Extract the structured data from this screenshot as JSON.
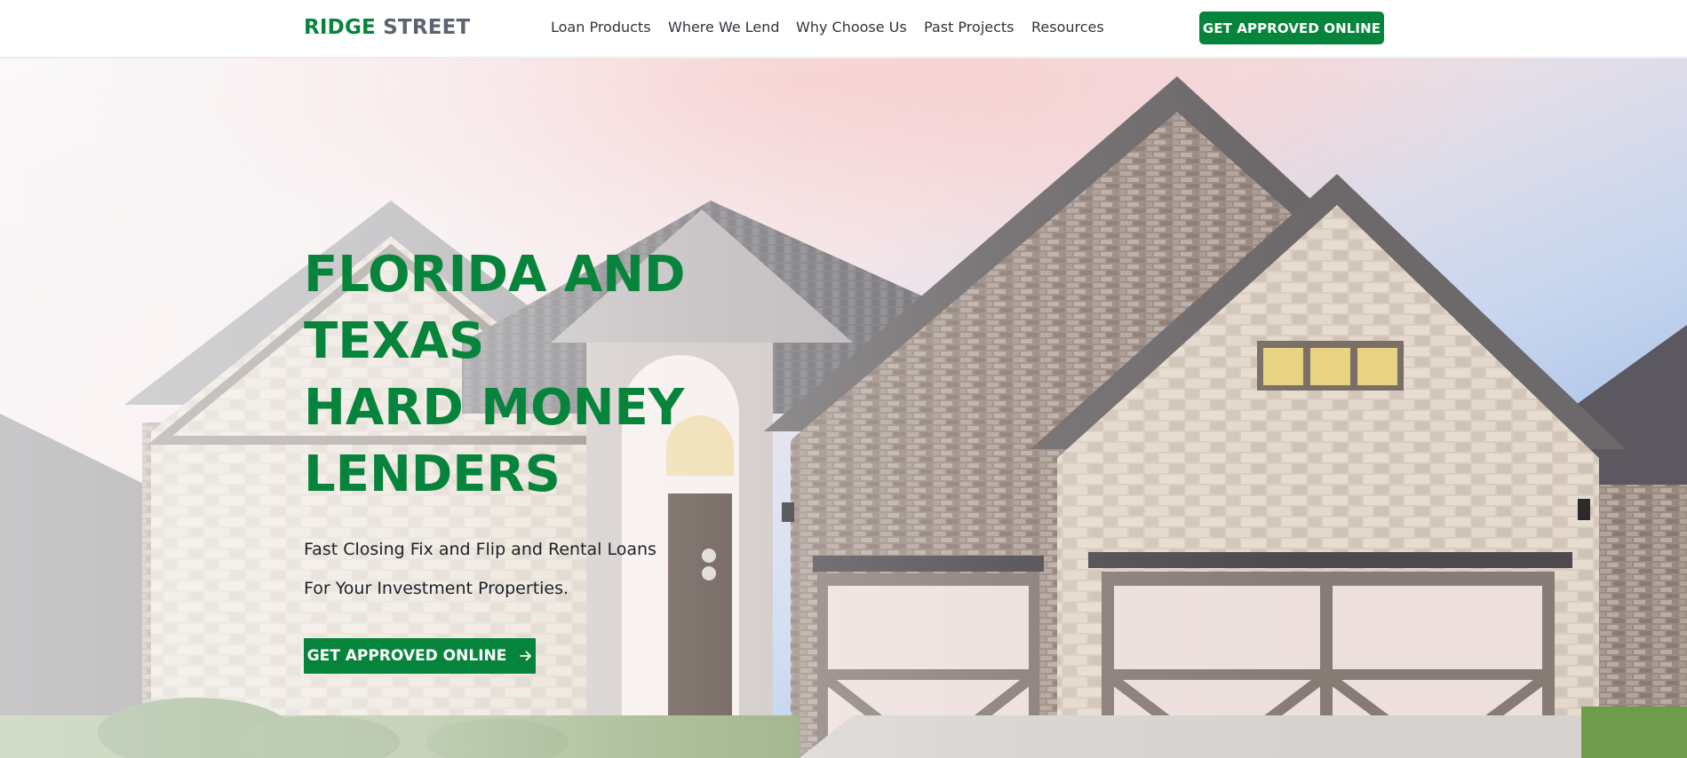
{
  "brand": {
    "part1": "RIDGE",
    "part2": "STREET"
  },
  "nav": {
    "links": [
      "Loan Products",
      "Where We Lend",
      "Why Choose Us",
      "Past Projects",
      "Resources"
    ],
    "cta_label": "GET APPROVED ONLINE"
  },
  "hero": {
    "headline_lines": [
      "FLORIDA AND",
      "TEXAS",
      "HARD MONEY",
      "LENDERS"
    ],
    "subhead_lines": [
      "Fast Closing Fix and Flip and Rental Loans",
      "For Your Investment Properties."
    ],
    "cta_label": "GET APPROVED ONLINE",
    "cta_icon": "arrow-right-icon",
    "background_image": "house-photo"
  },
  "colors": {
    "brand_green": "#07843c",
    "brand_gray": "#5c6470",
    "nav_text": "#2f353c",
    "body_text": "#1c2227"
  }
}
